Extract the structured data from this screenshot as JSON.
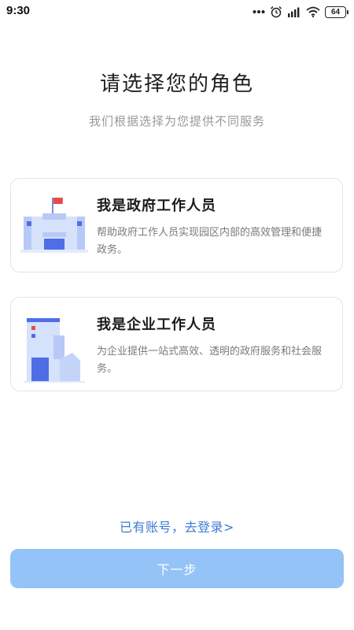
{
  "status_bar": {
    "time": "9:30",
    "battery": "64",
    "signal_label": "HD"
  },
  "page": {
    "title": "请选择您的角色",
    "subtitle": "我们根据选择为您提供不同服务"
  },
  "roles": [
    {
      "title": "我是政府工作人员",
      "description": "帮助政府工作人员实现园区内部的高效管理和便捷政务。",
      "icon": "government-building-icon"
    },
    {
      "title": "我是企业工作人员",
      "description": "为企业提供一站式高效、透明的政府服务和社会服务。",
      "icon": "enterprise-building-icon"
    }
  ],
  "login_link": "已有账号，去登录>",
  "next_button": "下一步",
  "colors": {
    "accent_link": "#3d7bd6",
    "button_bg": "#94c4f7",
    "illustration_blue": "#4f6ee6",
    "flag_red": "#e84a4a"
  }
}
